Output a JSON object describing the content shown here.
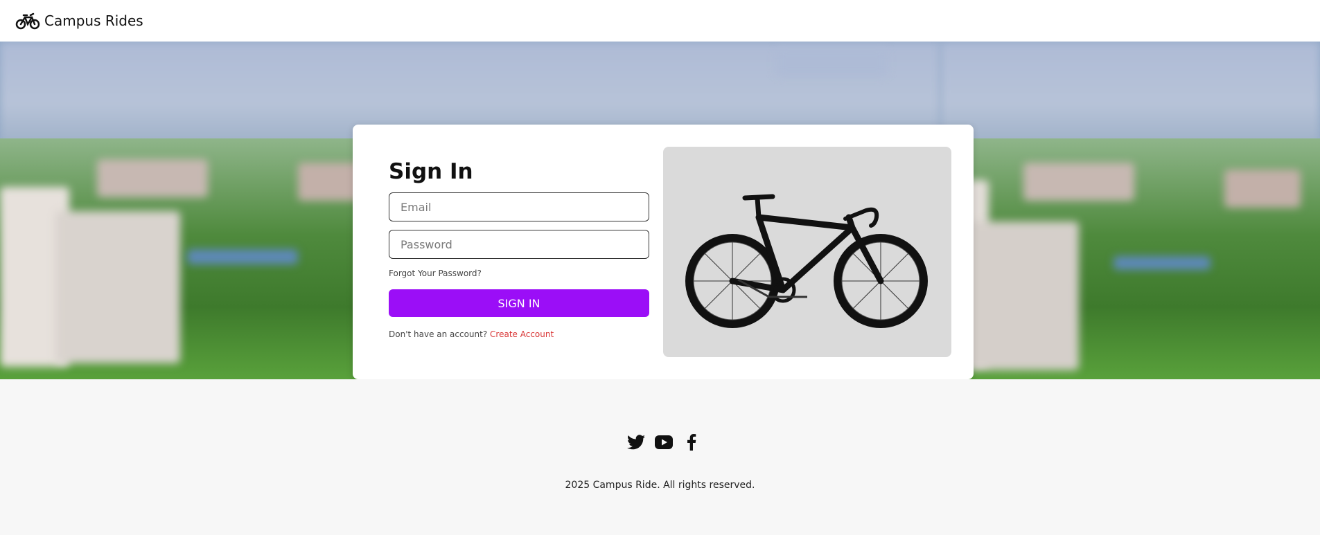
{
  "navbar": {
    "brand_icon": "bicycle-icon",
    "brand_name": "Campus Rides"
  },
  "hero": {
    "background_image": "blurred campus aerial photo",
    "signin_card": {
      "title": "Sign In",
      "email_placeholder": "Email",
      "password_placeholder": "Password",
      "forgot_password": "Forgot Your Password?",
      "signin_button": "SIGN IN",
      "no_account_text": "Don't have an account?",
      "create_account_link": "Create Account",
      "bike_image": "black road bike"
    }
  },
  "footer": {
    "social_icons": [
      "twitter-icon",
      "youtube-icon",
      "facebook-icon"
    ],
    "copyright": "2025 Campus Ride. All rights reserved."
  },
  "colors": {
    "accent": "#9b0ef7",
    "link": "#d93636"
  }
}
